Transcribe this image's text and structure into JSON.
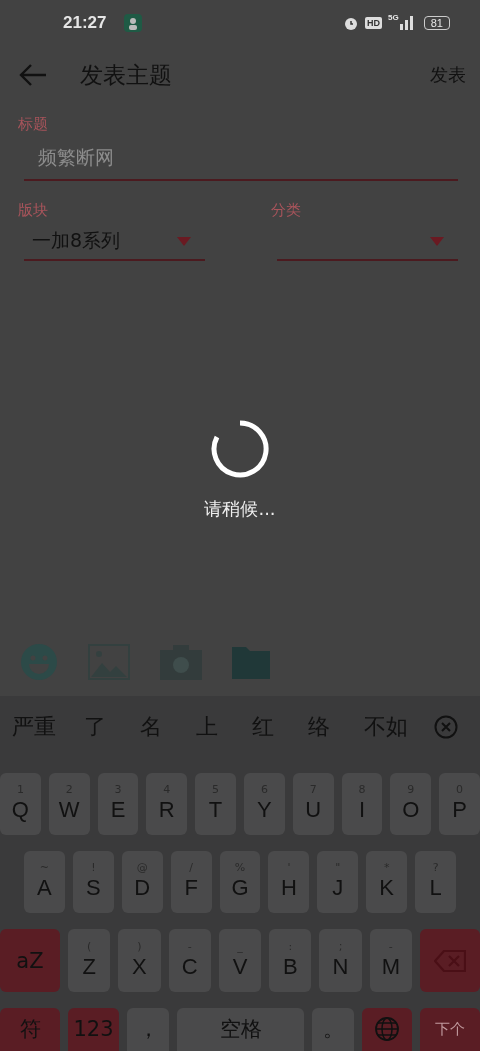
{
  "status_bar": {
    "time": "21:27",
    "network": "5G",
    "hd": "HD",
    "battery": "81"
  },
  "header": {
    "title": "发表主题",
    "action": "发表"
  },
  "form": {
    "title_field": {
      "label": "标题",
      "placeholder": "频繁断网"
    },
    "selects": [
      {
        "label": "版块",
        "value": "一加8系列"
      },
      {
        "label": "分类"
      }
    ]
  },
  "loading": {
    "text": "请稍候..."
  },
  "toolbar": [
    {
      "kind": "emoji"
    },
    {
      "kind": "image"
    },
    {
      "kind": "camera"
    },
    {
      "kind": "folder"
    }
  ],
  "keyboard": {
    "suggestions": [
      "严重",
      "了",
      "名",
      "上",
      "红",
      "络",
      "不如"
    ],
    "rows": [
      {
        "keys": [
          {
            "kind": "letter",
            "label": "Q",
            "hint": "1"
          },
          {
            "kind": "letter",
            "label": "W",
            "hint": "2"
          },
          {
            "kind": "letter",
            "label": "E",
            "hint": "3"
          },
          {
            "kind": "letter",
            "label": "R",
            "hint": "4"
          },
          {
            "kind": "letter",
            "label": "T",
            "hint": "5"
          },
          {
            "kind": "letter",
            "label": "Y",
            "hint": "6"
          },
          {
            "kind": "letter",
            "label": "U",
            "hint": "7"
          },
          {
            "kind": "letter",
            "label": "I",
            "hint": "8"
          },
          {
            "kind": "letter",
            "label": "O",
            "hint": "9"
          },
          {
            "kind": "letter",
            "label": "P",
            "hint": "0"
          }
        ]
      },
      {
        "keys": [
          {
            "kind": "letter",
            "label": "A",
            "hint": "~"
          },
          {
            "kind": "letter",
            "label": "S",
            "hint": "!"
          },
          {
            "kind": "letter",
            "label": "D",
            "hint": "@"
          },
          {
            "kind": "letter",
            "label": "F",
            "hint": "/"
          },
          {
            "kind": "letter",
            "label": "G",
            "hint": "%"
          },
          {
            "kind": "letter",
            "label": "H",
            "hint": "'"
          },
          {
            "kind": "letter",
            "label": "J",
            "hint": "\""
          },
          {
            "kind": "letter",
            "label": "K",
            "hint": "*"
          },
          {
            "kind": "letter",
            "label": "L",
            "hint": "?"
          }
        ]
      },
      {
        "keys": [
          {
            "kind": "function",
            "label": "aZ"
          },
          {
            "kind": "letter",
            "label": "Z",
            "hint": "("
          },
          {
            "kind": "letter",
            "label": "X",
            "hint": ")"
          },
          {
            "kind": "letter",
            "label": "C",
            "hint": "-"
          },
          {
            "kind": "letter",
            "label": "V",
            "hint": "_"
          },
          {
            "kind": "letter",
            "label": "B",
            "hint": ":"
          },
          {
            "kind": "letter",
            "label": "N",
            "hint": ";"
          },
          {
            "kind": "letter",
            "label": "M",
            "hint": "-"
          },
          {
            "kind": "backspace"
          }
        ]
      },
      {
        "keys": [
          {
            "kind": "function",
            "label": "符"
          },
          {
            "kind": "function",
            "label": "123"
          },
          {
            "kind": "plain",
            "label": "，"
          },
          {
            "kind": "space",
            "label": "空格"
          },
          {
            "kind": "plain",
            "label": "。"
          },
          {
            "kind": "globe"
          },
          {
            "kind": "action",
            "label": "下个"
          }
        ]
      }
    ]
  }
}
